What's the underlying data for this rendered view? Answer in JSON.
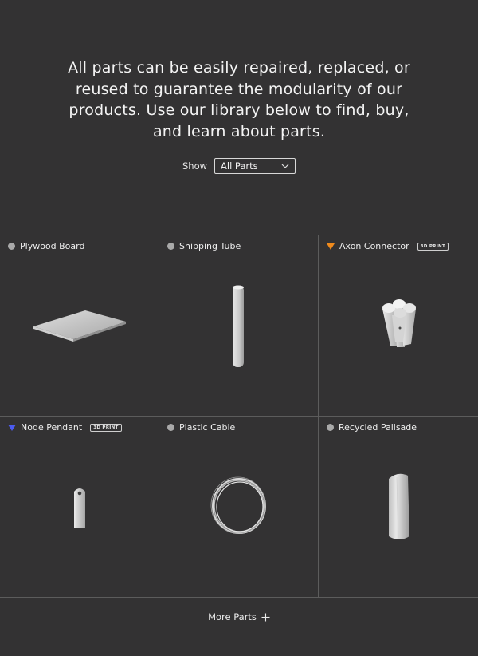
{
  "intro": {
    "lines": [
      "All parts can be easily repaired, replaced, or",
      "reused to guarantee the modularity of our",
      "products. Use our library below to find, buy,",
      "and learn about parts."
    ]
  },
  "filter": {
    "label": "Show",
    "selected": "All Parts"
  },
  "parts": [
    {
      "name": "Plywood Board",
      "marker": "circle",
      "marker_color": "#a9a9a9"
    },
    {
      "name": "Shipping Tube",
      "marker": "circle",
      "marker_color": "#a9a9a9"
    },
    {
      "name": "Axon Connector",
      "marker": "triangle",
      "marker_color": "#f08a1c",
      "badge": "3D PRINT"
    },
    {
      "name": "Node Pendant",
      "marker": "triangle",
      "marker_color": "#4b5bf0",
      "badge": "3D PRINT"
    },
    {
      "name": "Plastic Cable",
      "marker": "circle",
      "marker_color": "#a9a9a9"
    },
    {
      "name": "Recycled Palisade",
      "marker": "circle",
      "marker_color": "#a9a9a9"
    }
  ],
  "more": {
    "label": "More Parts"
  },
  "colors": {
    "background": "#333233",
    "grid_line": "#5c5c5c",
    "text": "#f2f2f2"
  }
}
